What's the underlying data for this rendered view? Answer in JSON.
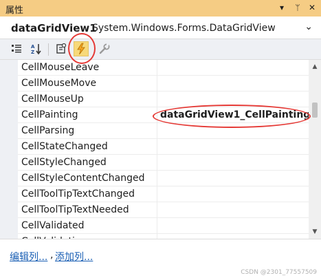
{
  "window": {
    "title": "属性",
    "dropdown_glyph": "▾",
    "pin_glyph": "ᛘ",
    "close_glyph": "✕"
  },
  "object_selector": {
    "name": "dataGridView1",
    "type": "System.Windows.Forms.DataGridView",
    "dropdown_glyph": "⌄"
  },
  "toolbar": {
    "buttons": [
      {
        "icon": "categorized-icon",
        "active": false
      },
      {
        "icon": "alphabetical-sort-icon",
        "active": false
      },
      {
        "icon": "properties-icon",
        "active": false
      },
      {
        "icon": "events-lightning-icon",
        "active": true
      },
      {
        "icon": "property-pages-wrench-icon",
        "active": false
      }
    ]
  },
  "events": {
    "rows": [
      {
        "name": "CellMouseLeave",
        "value": ""
      },
      {
        "name": "CellMouseMove",
        "value": ""
      },
      {
        "name": "CellMouseUp",
        "value": ""
      },
      {
        "name": "CellPainting",
        "value": "dataGridView1_CellPainting"
      },
      {
        "name": "CellParsing",
        "value": ""
      },
      {
        "name": "CellStateChanged",
        "value": ""
      },
      {
        "name": "CellStyleChanged",
        "value": ""
      },
      {
        "name": "CellStyleContentChanged",
        "value": ""
      },
      {
        "name": "CellToolTipTextChanged",
        "value": ""
      },
      {
        "name": "CellToolTipTextNeeded",
        "value": ""
      },
      {
        "name": "CellValidated",
        "value": ""
      },
      {
        "name": "CellValidating",
        "value": ""
      }
    ]
  },
  "footer": {
    "edit_columns": "编辑列...",
    "separator": ",",
    "add_column": "添加列..."
  },
  "watermark": "CSDN @2301_77557509",
  "colors": {
    "title_bar": "#f5cc84",
    "active_button": "#f7d97a",
    "link": "#1a5fb4",
    "annotation_ring": "#e53935"
  }
}
